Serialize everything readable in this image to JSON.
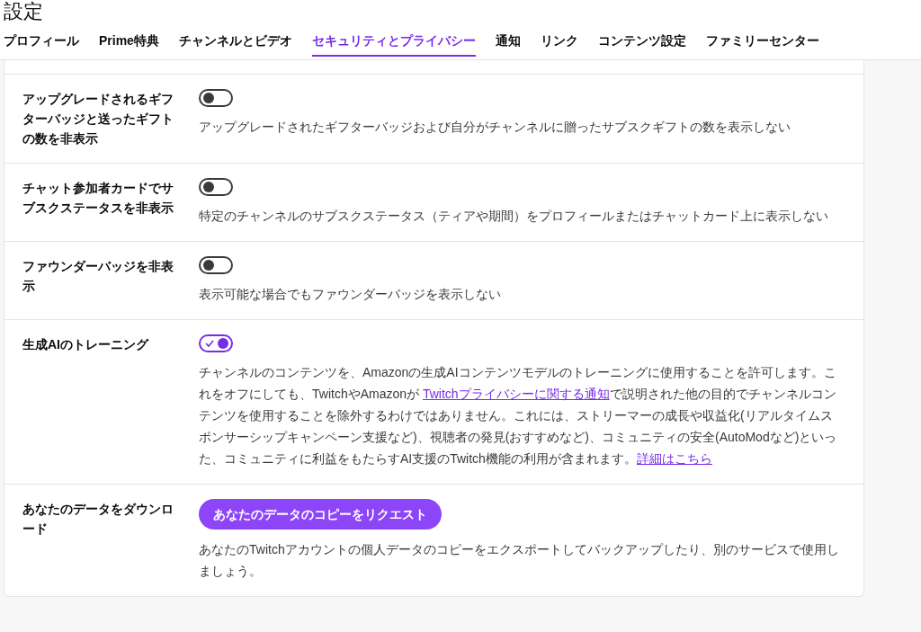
{
  "title": "設定",
  "tabs": [
    {
      "label": "プロフィール",
      "selected": false
    },
    {
      "label": "Prime特典",
      "selected": false
    },
    {
      "label": "チャンネルとビデオ",
      "selected": false
    },
    {
      "label": "セキュリティとプライバシー",
      "selected": true
    },
    {
      "label": "通知",
      "selected": false
    },
    {
      "label": "リンク",
      "selected": false
    },
    {
      "label": "コンテンツ設定",
      "selected": false
    },
    {
      "label": "ファミリーセンター",
      "selected": false
    }
  ],
  "settings": [
    {
      "kind": "toggle",
      "label": "アップグレードされるギフターバッジと送ったギフトの数を非表示",
      "on": false,
      "description": [
        {
          "kind": "text",
          "text": "アップグレードされたギフターバッジおよび自分がチャンネルに贈ったサブスクギフトの数を表示しない"
        }
      ]
    },
    {
      "kind": "toggle",
      "label": "チャット参加者カードでサブスクステータスを非表示",
      "on": false,
      "description": [
        {
          "kind": "text",
          "text": "特定のチャンネルのサブスクステータス（ティアや期間）をプロフィールまたはチャットカード上に表示しない"
        }
      ]
    },
    {
      "kind": "toggle",
      "label": "ファウンダーバッジを非表示",
      "on": false,
      "description": [
        {
          "kind": "text",
          "text": "表示可能な場合でもファウンダーバッジを表示しない"
        }
      ]
    },
    {
      "kind": "toggle",
      "label": "生成AIのトレーニング",
      "on": true,
      "description": [
        {
          "kind": "text",
          "text": "チャンネルのコンテンツを、Amazonの生成AIコンテンツモデルのトレーニングに使用することを許可します。これをオフにしても、TwitchやAmazonが "
        },
        {
          "kind": "link",
          "text": "Twitchプライバシーに関する通知"
        },
        {
          "kind": "text",
          "text": "で説明された他の目的でチャンネルコンテンツを使用することを除外するわけではありません。これには、ストリーマーの成長や収益化(リアルタイムスポンサーシップキャンペーン支援など)、視聴者の発見(おすすめなど)、コミュニティの安全(AutoModなど)といった、コミュニティに利益をもたらすAI支援のTwitch機能の利用が含まれます。"
        },
        {
          "kind": "link",
          "text": "詳細はこちら"
        }
      ]
    },
    {
      "kind": "button",
      "label": "あなたのデータをダウンロード",
      "button": "あなたのデータのコピーをリクエスト",
      "description": [
        {
          "kind": "text",
          "text": "あなたのTwitchアカウントの個人データのコピーをエクスポートしてバックアップしたり、別のサービスで使用しましょう。"
        }
      ]
    }
  ]
}
